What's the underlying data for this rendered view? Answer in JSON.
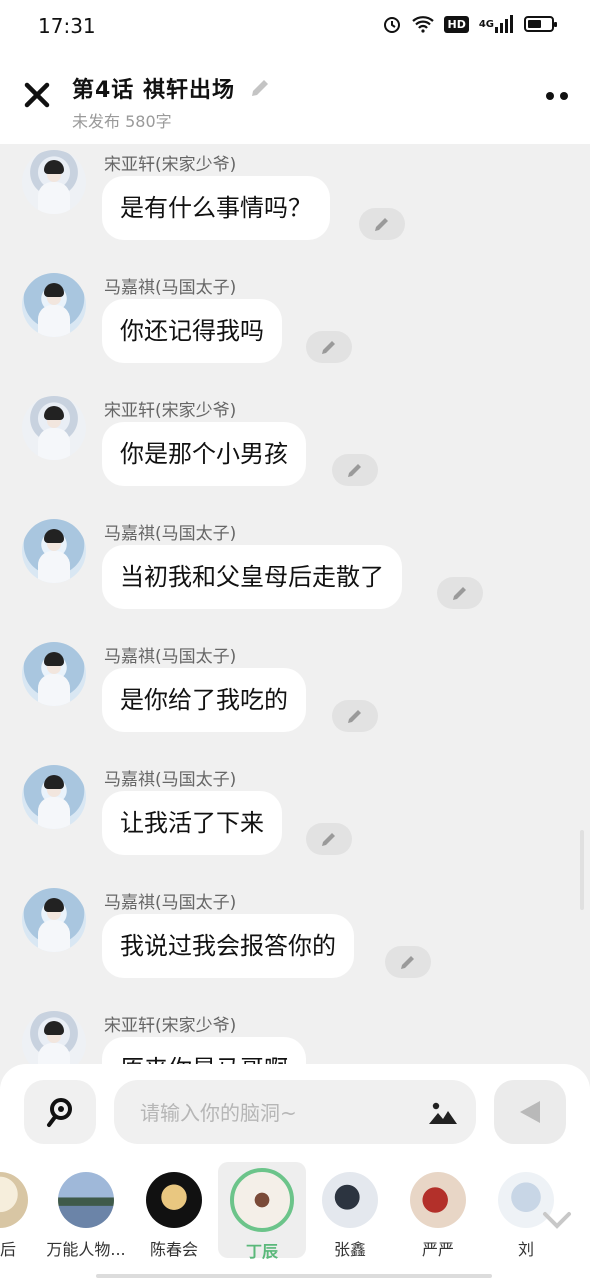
{
  "status": {
    "time": "17:31",
    "hd": "HD",
    "network": "4G",
    "battery_level": 0.6
  },
  "header": {
    "title": "第4话  祺轩出场",
    "subtitle": "未发布 580字"
  },
  "messages": [
    {
      "name": "宋亚轩(宋家少爷)",
      "text": "是有什么事情吗？",
      "avatar": "song"
    },
    {
      "name": "马嘉祺(马国太子)",
      "text": "你还记得我吗",
      "avatar": "ma"
    },
    {
      "name": "宋亚轩(宋家少爷)",
      "text": "你是那个小男孩",
      "avatar": "song"
    },
    {
      "name": "马嘉祺(马国太子)",
      "text": "当初我和父皇母后走散了",
      "avatar": "ma"
    },
    {
      "name": "马嘉祺(马国太子)",
      "text": "是你给了我吃的",
      "avatar": "ma"
    },
    {
      "name": "马嘉祺(马国太子)",
      "text": "让我活了下来",
      "avatar": "ma"
    },
    {
      "name": "马嘉祺(马国太子)",
      "text": "我说过我会报答你的",
      "avatar": "ma"
    },
    {
      "name": "宋亚轩(宋家少爷)",
      "text": "原来你是马哥啊",
      "avatar": "song"
    }
  ],
  "input": {
    "placeholder": "请输入你的脑洞~",
    "value": ""
  },
  "roles": [
    {
      "name": "皇后",
      "color": "#e8dcc4"
    },
    {
      "name": "万能人物...",
      "color": "#6f8fb8"
    },
    {
      "name": "陈春会",
      "color": "#2a1a10"
    },
    {
      "name": "丁辰",
      "color": "#f3efe8"
    },
    {
      "name": "张鑫",
      "color": "#dfe4ea"
    },
    {
      "name": "严严",
      "color": "#b5473f"
    },
    {
      "name": "刘",
      "color": "#d9e2ec"
    }
  ],
  "colors": {
    "accent": "#5ab87a",
    "bubble": "#ffffff",
    "background": "#f0f0f0"
  }
}
